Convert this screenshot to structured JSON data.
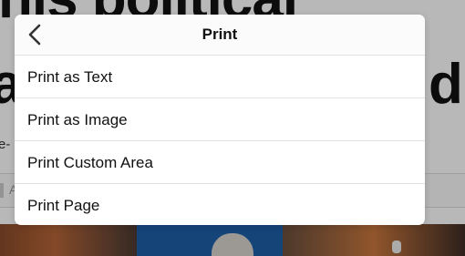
{
  "background": {
    "headline_line1": "his political",
    "headline_line2": "a",
    "headline_line2_tail": "d",
    "byline_fragment": "e-",
    "bar_fragment": "A"
  },
  "dialog": {
    "title": "Print",
    "back_icon": "chevron-left-icon",
    "options": [
      {
        "label": "Print as Text"
      },
      {
        "label": "Print as Image"
      },
      {
        "label": "Print Custom Area"
      },
      {
        "label": "Print Page"
      }
    ]
  },
  "colors": {
    "overlay": "rgba(0,0,0,0.28)",
    "dialog_bg": "#ffffff",
    "divider": "#e2e2e2",
    "text": "#111111",
    "photo_blue": "#1e5fa8"
  }
}
